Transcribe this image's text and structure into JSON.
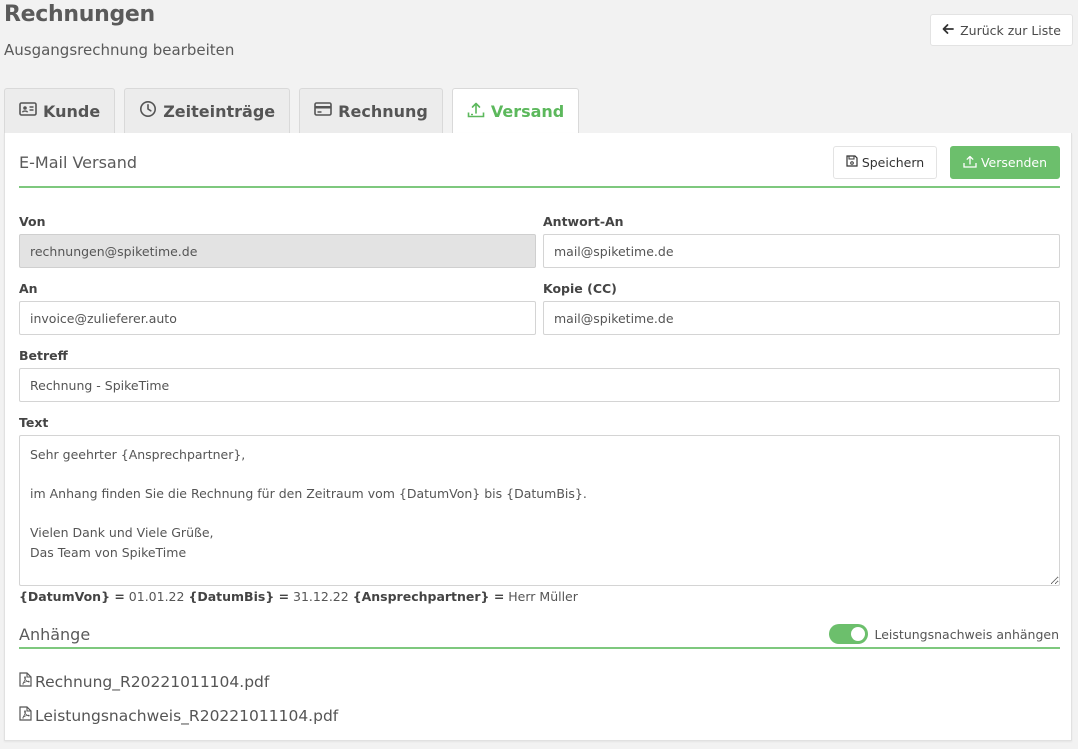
{
  "header": {
    "title": "Rechnungen",
    "subtitle": "Ausgangsrechnung bearbeiten",
    "back_label": "Zurück zur Liste"
  },
  "tabs": [
    {
      "label": "Kunde",
      "icon": "id-card-icon"
    },
    {
      "label": "Zeiteinträge",
      "icon": "clock-icon"
    },
    {
      "label": "Rechnung",
      "icon": "credit-card-icon"
    },
    {
      "label": "Versand",
      "icon": "upload-tray-icon",
      "active": true
    }
  ],
  "email_section": {
    "title": "E-Mail Versand",
    "save_label": "Speichern",
    "send_label": "Versenden"
  },
  "fields": {
    "von": {
      "label": "Von",
      "value": "rechnungen@spiketime.de"
    },
    "antwort_an": {
      "label": "Antwort-An",
      "value": "mail@spiketime.de"
    },
    "an": {
      "label": "An",
      "value": "invoice@zulieferer.auto"
    },
    "kopie": {
      "label": "Kopie (CC)",
      "value": "mail@spiketime.de"
    },
    "betreff": {
      "label": "Betreff",
      "value": "Rechnung - SpikeTime"
    },
    "text": {
      "label": "Text",
      "value": "Sehr geehrter {Ansprechpartner},\n\nim Anhang finden Sie die Rechnung für den Zeitraum vom {DatumVon} bis {DatumBis}.\n\nVielen Dank und Viele Grüße,\nDas Team von SpikeTime"
    }
  },
  "placeholders": [
    {
      "key": "{DatumVon} =",
      "value": "01.01.22"
    },
    {
      "key": "{DatumBis} =",
      "value": "31.12.22"
    },
    {
      "key": "{Ansprechpartner} =",
      "value": "Herr Müller"
    }
  ],
  "attachments": {
    "title": "Anhänge",
    "toggle_label": "Leistungsnachweis anhängen",
    "toggle_on": true,
    "files": [
      "Rechnung_R20221011104.pdf",
      "Leistungsnachweis_R20221011104.pdf"
    ]
  },
  "colors": {
    "accent": "#6cbf6c",
    "tab_active": "#5cb85c"
  }
}
